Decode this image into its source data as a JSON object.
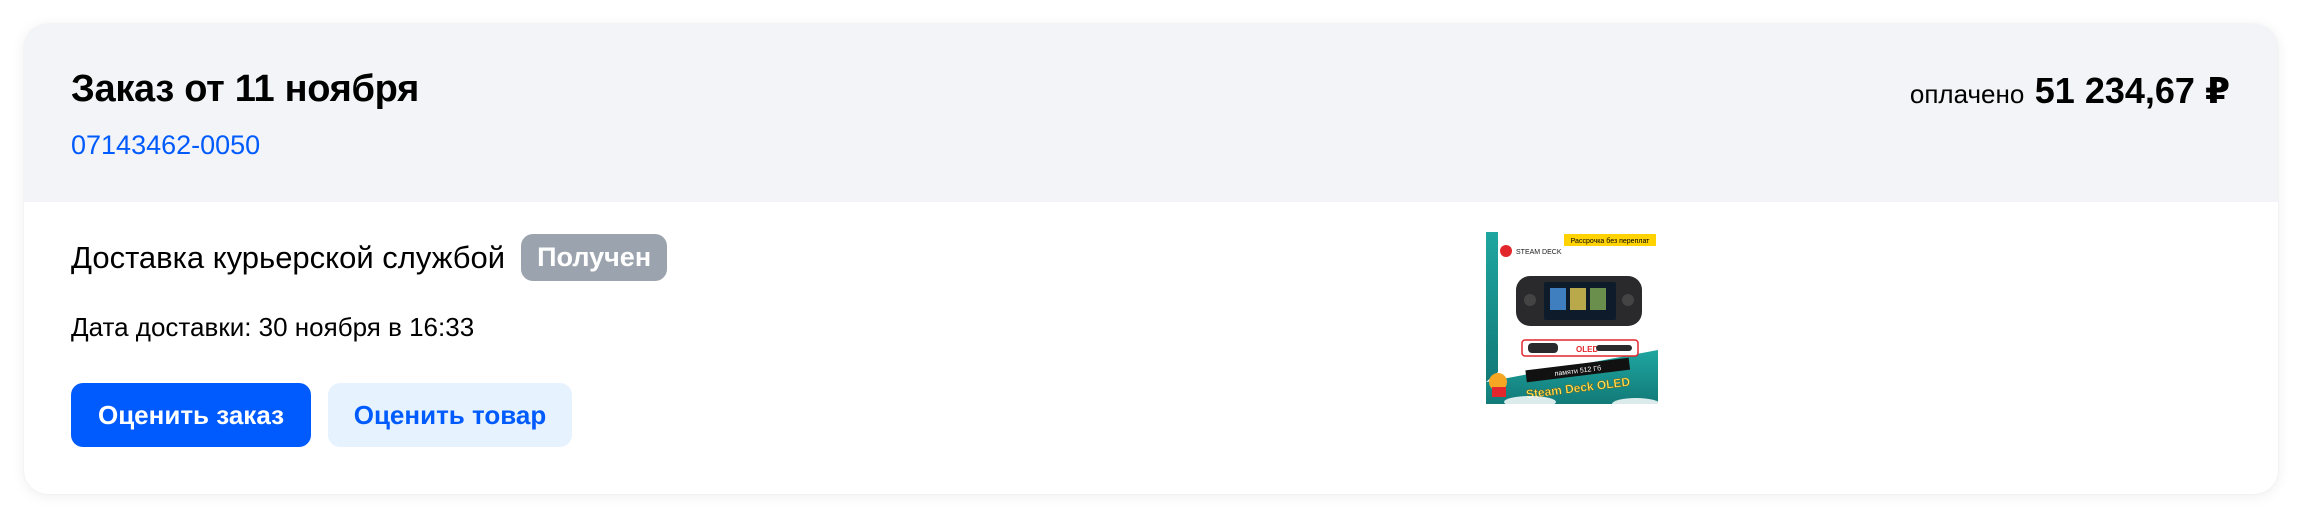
{
  "order": {
    "title": "Заказ от 11 ноября",
    "number": "07143462-0050",
    "paid_label": "оплачено",
    "paid_amount": "51 234,67 ₽"
  },
  "delivery": {
    "title": "Доставка курьерской службой",
    "status": "Получен",
    "date": "Дата доставки: 30 ноября в 16:33"
  },
  "actions": {
    "rate_order": "Оценить заказ",
    "rate_product": "Оценить товар"
  },
  "product_image": {
    "brand": "STEAM DECK",
    "promo": "Рассрочка без переплат",
    "memory": "памяти 512 Гб",
    "name": "Steam Deck OLED",
    "oled": "OLED"
  },
  "colors": {
    "accent": "#005bff",
    "header_bg": "#f3f4f7",
    "status_badge": "#9ba3ae",
    "secondary_button_bg": "#e6f3ff"
  }
}
